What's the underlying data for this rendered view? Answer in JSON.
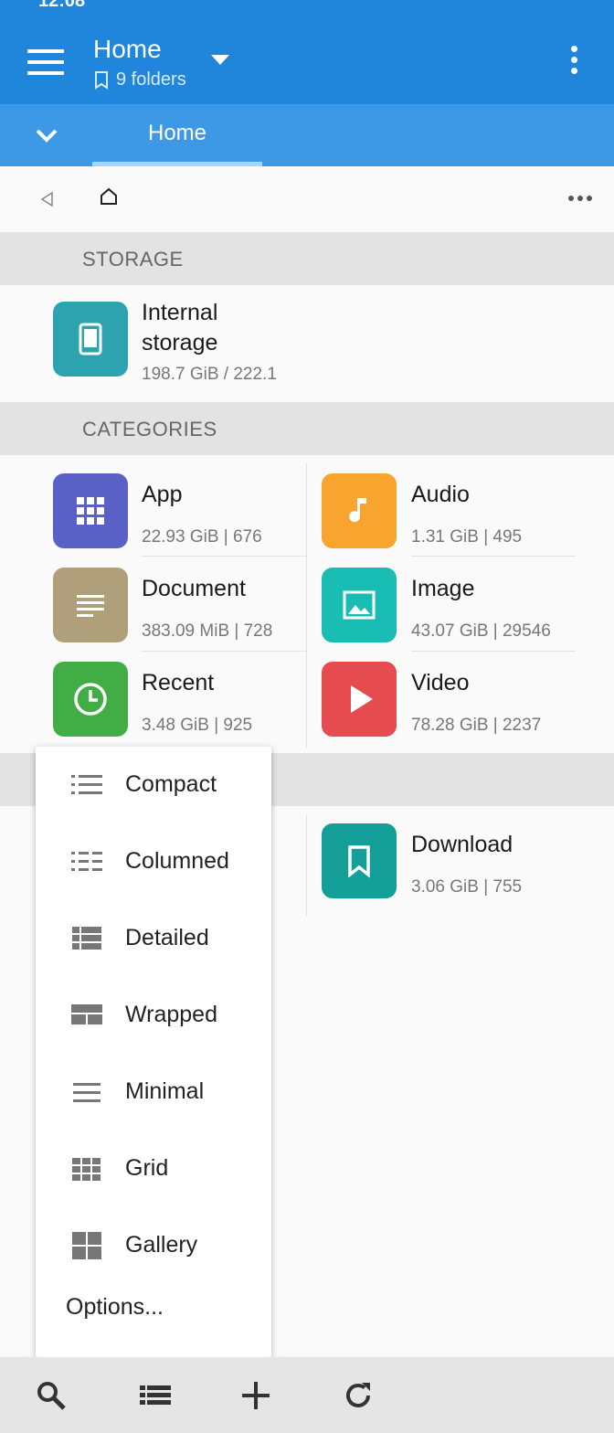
{
  "status_bar": {
    "time": "12:08",
    "right": ""
  },
  "app_bar": {
    "title": "Home",
    "subtitle": "9 folders"
  },
  "tabs": {
    "active": "Home"
  },
  "sections": {
    "storage": "STORAGE",
    "categories": "CATEGORIES"
  },
  "storage": {
    "name_line1": "Internal",
    "name_line2": "storage",
    "usage": "198.7 GiB / 222.1",
    "color": "#2ea3b0"
  },
  "categories": [
    {
      "name": "App",
      "meta": "22.93 GiB | 676",
      "color": "#5961c7"
    },
    {
      "name": "Audio",
      "meta": "1.31 GiB | 495",
      "color": "#f8a530"
    },
    {
      "name": "Document",
      "meta": "383.09 MiB | 728",
      "color": "#b09f7b"
    },
    {
      "name": "Image",
      "meta": "43.07 GiB | 29546",
      "color": "#19bdb4"
    },
    {
      "name": "Recent",
      "meta": "3.48 GiB | 925",
      "color": "#43ad45"
    },
    {
      "name": "Video",
      "meta": "78.28 GiB | 2237",
      "color": "#e54b4f"
    }
  ],
  "bookmarks": [
    {
      "name": "Download",
      "meta": "3.06 GiB | 755",
      "color": "#139f98"
    }
  ],
  "view_menu": {
    "items": [
      "Compact",
      "Columned",
      "Detailed",
      "Wrapped",
      "Minimal",
      "Grid",
      "Gallery"
    ],
    "options": "Options..."
  },
  "colors": {
    "primary": "#1f86dc",
    "tab_bar": "#3d99e6",
    "icon_gray": "#777777"
  }
}
